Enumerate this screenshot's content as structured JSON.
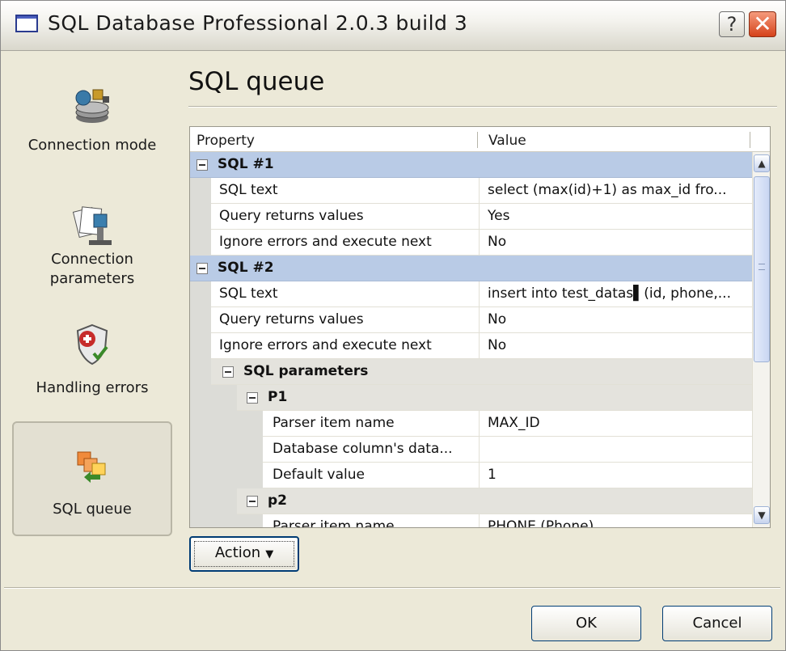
{
  "window": {
    "title": "SQL Database Professional 2.0.3 build 3",
    "help_label": "?",
    "close_label": "✕"
  },
  "sidebar": {
    "items": [
      {
        "label": "Connection mode",
        "icon": "database-icon"
      },
      {
        "label": "Connection parameters",
        "icon": "connection-icon"
      },
      {
        "label": "Handling errors",
        "icon": "shield-error-icon"
      },
      {
        "label": "SQL  queue",
        "icon": "queue-icon",
        "selected": true
      }
    ]
  },
  "content": {
    "title": "SQL queue"
  },
  "grid": {
    "header": {
      "property": "Property",
      "value": "Value"
    },
    "rows": [
      {
        "type": "group",
        "label": "SQL #1"
      },
      {
        "type": "item",
        "property": "SQL text",
        "value": "select (max(id)+1) as max_id fro..."
      },
      {
        "type": "item",
        "property": "Query returns values",
        "value": "Yes"
      },
      {
        "type": "item",
        "property": "Ignore errors and execute next",
        "value": "No"
      },
      {
        "type": "group",
        "label": "SQL #2"
      },
      {
        "type": "item",
        "property": "SQL text",
        "value": "insert into test_datas▌(id, phone,..."
      },
      {
        "type": "item",
        "property": "Query returns values",
        "value": "No"
      },
      {
        "type": "item",
        "property": "Ignore errors and execute next",
        "value": "No"
      },
      {
        "type": "subgroup",
        "label": "SQL parameters"
      },
      {
        "type": "subgroup2",
        "label": "P1"
      },
      {
        "type": "item2",
        "property": "Parser item name",
        "value": "MAX_ID"
      },
      {
        "type": "item2",
        "property": "Database column's data...",
        "value": ""
      },
      {
        "type": "item2",
        "property": "Default value",
        "value": "1"
      },
      {
        "type": "subgroup2",
        "label": "p2"
      },
      {
        "type": "item2",
        "property": "Parser item name",
        "value": "PHONE (Phone)"
      }
    ]
  },
  "buttons": {
    "action": "Action",
    "ok": "OK",
    "cancel": "Cancel"
  }
}
